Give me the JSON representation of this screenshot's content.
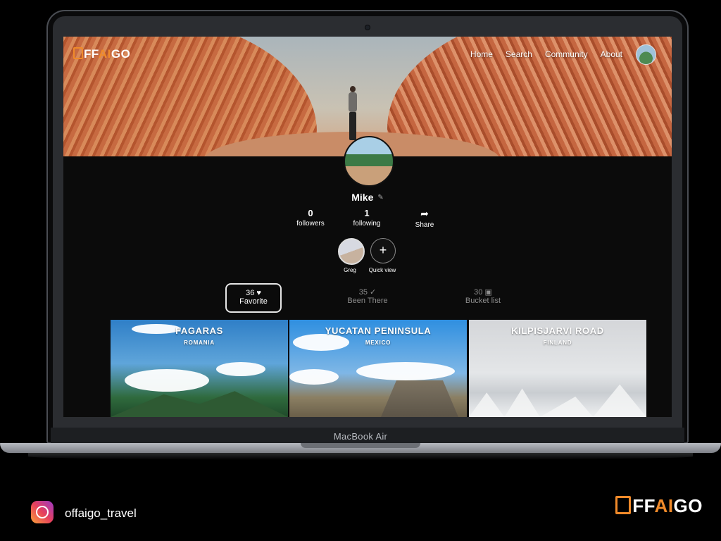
{
  "site": {
    "logo_prefix": "FF",
    "logo_ai": "AI",
    "logo_suffix": "GO",
    "nav": [
      "Home",
      "Search",
      "Community",
      "About"
    ]
  },
  "profile": {
    "name": "Mike",
    "followers_count": "0",
    "followers_label": "followers",
    "following_count": "1",
    "following_label": "following",
    "share_label": "Share",
    "friend_name": "Greg",
    "quick_view_label": "Quick view"
  },
  "tabs": [
    {
      "count": "36",
      "icon": "heart-icon",
      "glyph": "♥",
      "label": "Favorite",
      "active": true
    },
    {
      "count": "35",
      "icon": "check-icon",
      "glyph": "✓",
      "label": "Been There",
      "active": false
    },
    {
      "count": "30",
      "icon": "bag-icon",
      "glyph": "🛍",
      "label": "Bucket list",
      "active": false
    }
  ],
  "destinations": [
    {
      "title": "FAGARAS",
      "country": "ROMANIA"
    },
    {
      "title": "YUCATAN PENINSULA",
      "country": "MEXICO"
    },
    {
      "title": "KILPISJARVI ROAD",
      "country": "FINLAND"
    }
  ],
  "device": {
    "label": "MacBook Air"
  },
  "footer": {
    "instagram_handle": "offaigo_travel",
    "brand_prefix": "FF",
    "brand_ai": "AI",
    "brand_suffix": "GO"
  },
  "colors": {
    "accent": "#f08a2a",
    "background": "#000000"
  }
}
